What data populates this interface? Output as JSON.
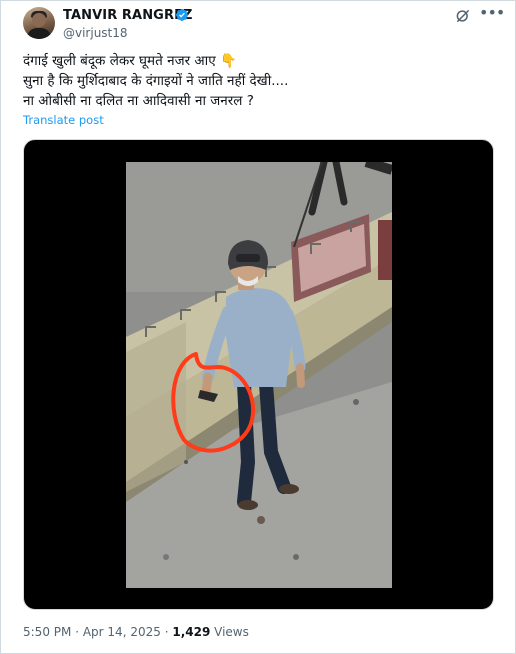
{
  "author": {
    "name": "TANVIR RANGREZ",
    "handle": "@virjust18",
    "verified": true
  },
  "post": {
    "lines": [
      "दंगाई खुली बंदूक लेकर घूमते नजर आए 👇",
      "सुना है कि मुर्शिदाबाद के दंगाइयों ने जाति नहीं देखी....",
      "ना ओबीसी ना दलित ना आदिवासी ना जनरल ?"
    ],
    "translate_label": "Translate post"
  },
  "actions": {
    "grok_icon": "grok-icon",
    "more_icon": "more-dots-icon"
  },
  "media": {
    "type": "video",
    "description_icon": "video-frame"
  },
  "meta": {
    "time": "5:50 PM",
    "separator": "·",
    "date": "Apr 14, 2025",
    "views_count": "1,429",
    "views_label": "Views"
  },
  "colors": {
    "accent": "#1d9bf0",
    "secondary_text": "#536471",
    "annotation_circle": "#ff3b1a"
  }
}
